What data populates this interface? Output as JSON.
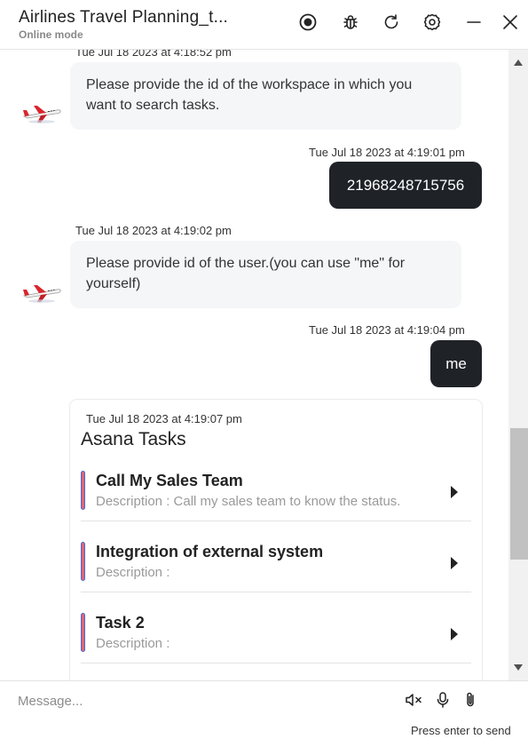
{
  "header": {
    "title": "Airlines Travel Planning_t...",
    "subtitle": "Online mode",
    "icons": [
      "record-icon",
      "bug-icon",
      "refresh-icon",
      "settings-icon",
      "minimize-icon",
      "close-icon"
    ]
  },
  "messages": [
    {
      "sender": "bot",
      "timestamp": "Tue Jul 18 2023 at 4:18:52 pm",
      "text": "Please provide the id of the workspace in which you want to search tasks."
    },
    {
      "sender": "user",
      "timestamp": "Tue Jul 18 2023 at 4:19:01 pm",
      "text": "21968248715756"
    },
    {
      "sender": "bot",
      "timestamp": "Tue Jul 18 2023 at 4:19:02 pm",
      "text": "Please provide id of the user.(you can use \"me\" for yourself)"
    },
    {
      "sender": "user",
      "timestamp": "Tue Jul 18 2023 at 4:19:04 pm",
      "text": "me"
    }
  ],
  "card": {
    "timestamp": "Tue Jul 18 2023 at 4:19:07 pm",
    "title": "Asana Tasks",
    "tasks": [
      {
        "name": "Call My Sales Team",
        "description": "Description : Call my sales team to know the status."
      },
      {
        "name": "Integration of external system",
        "description": "Description :"
      },
      {
        "name": "Task 2",
        "description": "Description :"
      }
    ]
  },
  "footer": {
    "placeholder": "Message...",
    "hint": "Press enter to send",
    "icons": [
      "mute-icon",
      "microphone-icon",
      "attachment-icon"
    ]
  },
  "colors": {
    "user_bubble": "#1f2328",
    "bot_bubble": "#f5f6f8",
    "task_bar": "#e0637a",
    "task_bar_border": "#4b6cc7"
  }
}
